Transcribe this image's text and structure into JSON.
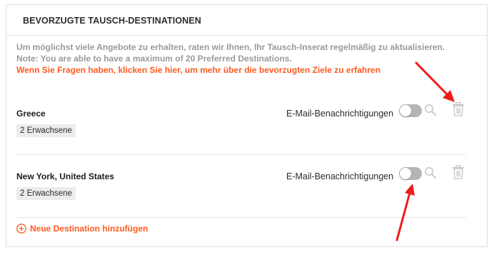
{
  "panel": {
    "title": "BEVORZUGTE TAUSCH-DESTINATIONEN"
  },
  "intro": {
    "line1": "Um möglichst viele Angebote zu erhalten, raten wir Ihnen, Ihr Tausch-Inserat regelmäßig zu aktualisieren.",
    "line2": "Note: You are able to have a maximum of 20 Preferred Destinations.",
    "link": "Wenn Sie Fragen haben, klicken Sie hier, um mehr über die bevorzugten Ziele zu erfahren"
  },
  "destinations": [
    {
      "name": "Greece",
      "notification_label": "E-Mail-Benachrichtigungen",
      "notification_enabled": false,
      "guests": "2 Erwachsene",
      "icons": [
        "toggle-switch",
        "search-icon",
        "trash-icon"
      ]
    },
    {
      "name": "New York, United States",
      "notification_label": "E-Mail-Benachrichtigungen",
      "notification_enabled": false,
      "guests": "2 Erwachsene",
      "icons": [
        "toggle-switch",
        "search-icon",
        "trash-icon"
      ]
    }
  ],
  "add_destination": {
    "label": "Neue Destination hinzufügen",
    "icon": "plus-circle-icon"
  },
  "colors": {
    "accent": "#ff5a1f",
    "annotation_arrow": "#ee1c1c",
    "muted_text": "#9a9a9a",
    "toggle_off": "#b5b5b5"
  }
}
